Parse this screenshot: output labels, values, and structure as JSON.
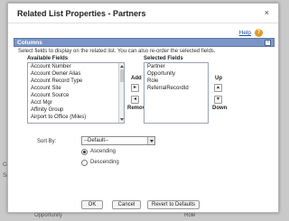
{
  "background": {
    "texts": [
      "Co",
      "Sa",
      "Opportunity",
      "Role"
    ]
  },
  "dialog": {
    "title": "Related List Properties - Partners",
    "close_glyph": "×",
    "help_label": "Help",
    "help_glyph": "?"
  },
  "columns_section": {
    "title": "Columns",
    "collapse_glyph": "−",
    "description": "Select fields to display on the related list. You can also re-order the selected fields."
  },
  "available_fields": {
    "label": "Available Fields",
    "items": [
      "Account Number",
      "Account Owner Alias",
      "Account Record Type",
      "Account Site",
      "Account Source",
      "Acct Mgr",
      "Affinity Group",
      "Airport to Office (Miles)"
    ]
  },
  "add_remove": {
    "add_label": "Add",
    "add_glyph": "▸",
    "remove_glyph": "◂",
    "remove_label": "Remove"
  },
  "selected_fields": {
    "label": "Selected Fields",
    "items": [
      "Partner",
      "Opportunity",
      "Role",
      "ReferralRecordId"
    ]
  },
  "up_down": {
    "up_label": "Up",
    "up_glyph": "▴",
    "down_glyph": "▾",
    "down_label": "Down"
  },
  "sort": {
    "label": "Sort By:",
    "selected": "--Default--",
    "options": [
      {
        "label": "Ascending",
        "checked": true
      },
      {
        "label": "Descending",
        "checked": false
      }
    ]
  },
  "footer": {
    "ok_label": "OK",
    "cancel_label": "Cancel",
    "revert_label": "Revert to Defaults"
  }
}
